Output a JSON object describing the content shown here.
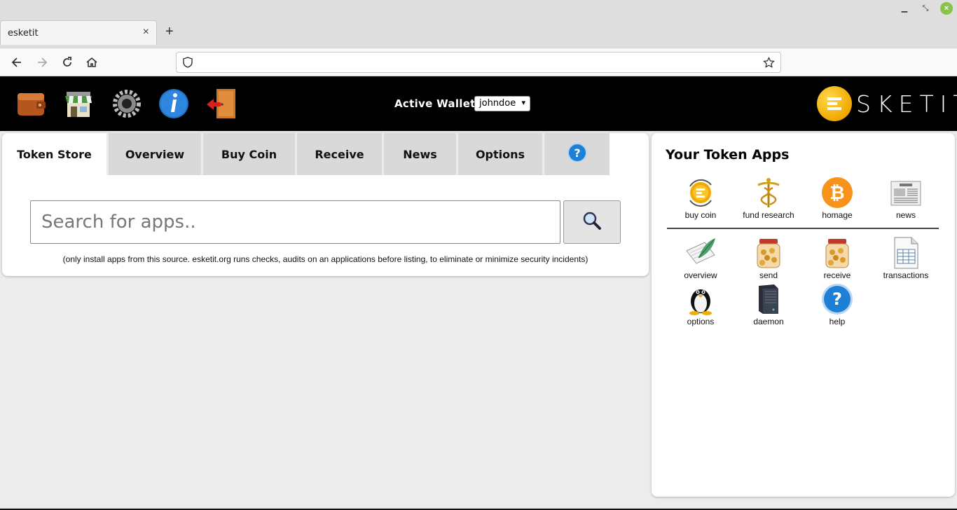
{
  "browser": {
    "tab_title": "esketit",
    "tab_close": "×",
    "new_tab": "+",
    "url": ""
  },
  "header": {
    "wallet_label": "Active Wallet:",
    "wallet_selected": "johndoe",
    "brand_text": "SKETIT",
    "icons": [
      "wallet-icon",
      "store-icon",
      "gear-icon",
      "info-icon",
      "exit-icon"
    ]
  },
  "store": {
    "tabs": [
      "Token Store",
      "Overview",
      "Buy Coin",
      "Receive",
      "News",
      "Options"
    ],
    "search_placeholder": "Search for apps..",
    "disclaimer": "(only install apps from this source. esketit.org runs checks, audits on an applications before listing, to eliminate or minimize security incidents)"
  },
  "apps": {
    "title": "Your Token Apps",
    "pinned": [
      {
        "label": "buy coin",
        "icon": "coin-refresh-icon"
      },
      {
        "label": "fund research",
        "icon": "caduceus-icon"
      },
      {
        "label": "homage",
        "icon": "bitcoin-icon"
      },
      {
        "label": "news",
        "icon": "newspaper-icon"
      }
    ],
    "installed": [
      {
        "label": "overview",
        "icon": "notepad-icon"
      },
      {
        "label": "send",
        "icon": "coin-jar-icon"
      },
      {
        "label": "receive",
        "icon": "coin-jar-icon"
      },
      {
        "label": "transactions",
        "icon": "spreadsheet-icon"
      },
      {
        "label": "options",
        "icon": "penguin-icon"
      },
      {
        "label": "daemon",
        "icon": "server-icon"
      },
      {
        "label": "help",
        "icon": "help-icon"
      }
    ]
  },
  "colors": {
    "header_bg": "#000000",
    "brand_gold": "#f0a800",
    "tab_inactive": "#d9d9d9",
    "page_bg": "#ececec"
  }
}
